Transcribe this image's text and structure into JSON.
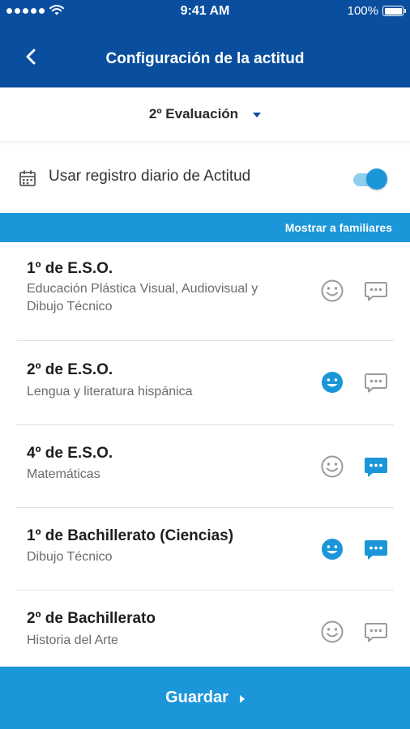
{
  "status_bar": {
    "time": "9:41 AM",
    "battery": "100%"
  },
  "header": {
    "title": "Configuración de la actitud"
  },
  "period": {
    "label": "2º Evaluación"
  },
  "daily_record": {
    "label": "Usar registro diario de Actitud",
    "enabled": true
  },
  "show_bar": {
    "label": "Mostrar a familiares"
  },
  "courses": [
    {
      "title": "1º de E.S.O.",
      "subtitle": "Educación Plástica Visual, Audiovisual y Dibujo Técnico",
      "face_active": false,
      "chat_active": false
    },
    {
      "title": "2º de E.S.O.",
      "subtitle": "Lengua y literatura hispánica",
      "face_active": true,
      "chat_active": false
    },
    {
      "title": "4º de E.S.O.",
      "subtitle": "Matemáticas",
      "face_active": false,
      "chat_active": true
    },
    {
      "title": "1º de Bachillerato (Ciencias)",
      "subtitle": "Dibujo Técnico",
      "face_active": true,
      "chat_active": true
    },
    {
      "title": "2º de Bachillerato",
      "subtitle": "Historia del Arte",
      "face_active": false,
      "chat_active": false
    }
  ],
  "footer": {
    "save_label": "Guardar"
  },
  "colors": {
    "header": "#0a4f9f",
    "accent": "#1b96d8",
    "inactive_icon": "#9b9b9b"
  },
  "icons": {
    "back": "back-arrow-icon",
    "calendar": "calendar-icon",
    "face": "smiley-face-icon",
    "chat": "chat-bubble-icon",
    "dropdown": "caret-down-icon"
  }
}
